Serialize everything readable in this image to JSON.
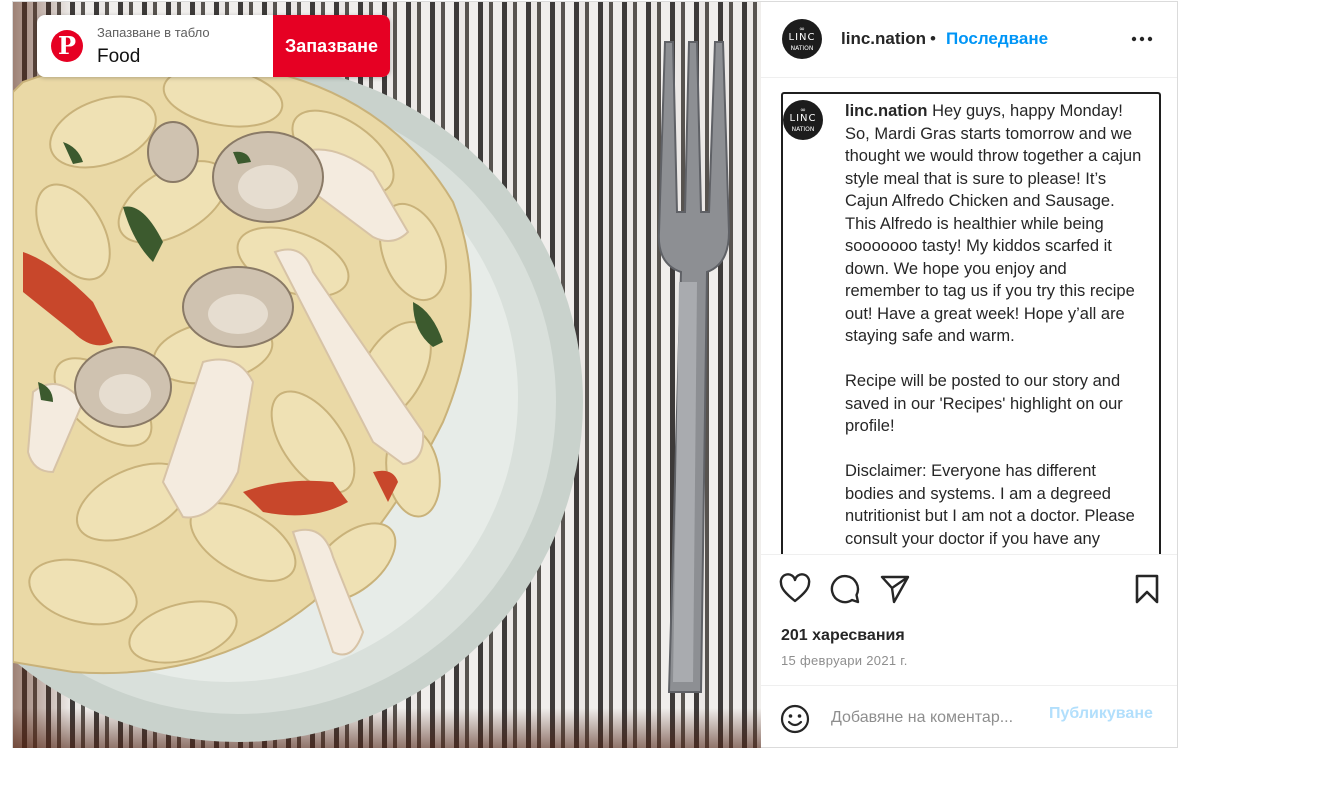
{
  "pinterest": {
    "logo_letter": "P",
    "hint": "Запазване в табло",
    "board": "Food",
    "save_label": "Запазване"
  },
  "post": {
    "avatar": {
      "top": "∞",
      "middle": "LINC",
      "bottom": "NATION"
    },
    "username": "linc.nation",
    "separator": "•",
    "follow_label": "Последване",
    "caption_user": "linc.nation",
    "caption_text": " Hey guys, happy Monday! So, Mardi Gras starts tomorrow and we thought we would throw together a cajun style meal that is sure to please! It’s Cajun Alfredo Chicken and Sausage. This Alfredo is healthier while being sooooooo tasty! My kiddos scarfed it down. We hope you enjoy and remember to tag us if you try this recipe out! Have a great week! Hope y’all are staying safe and warm.\n\nRecipe will be posted to our story and saved in our 'Recipes' highlight on our profile!\n\nDisclaimer: Everyone has different bodies and systems. I am a degreed nutritionist but I am not a doctor. Please consult your doctor if you have any serious health concerns.",
    "likes": "201 харесвания",
    "date": "15 февруари 2021 г.",
    "comment_placeholder": "Добавяне на коментар...",
    "publish_label": "Публикуване"
  },
  "colors": {
    "pinterest_red": "#e60023",
    "follow_blue": "#0095f6",
    "publish_disabled": "#b2dffc"
  }
}
